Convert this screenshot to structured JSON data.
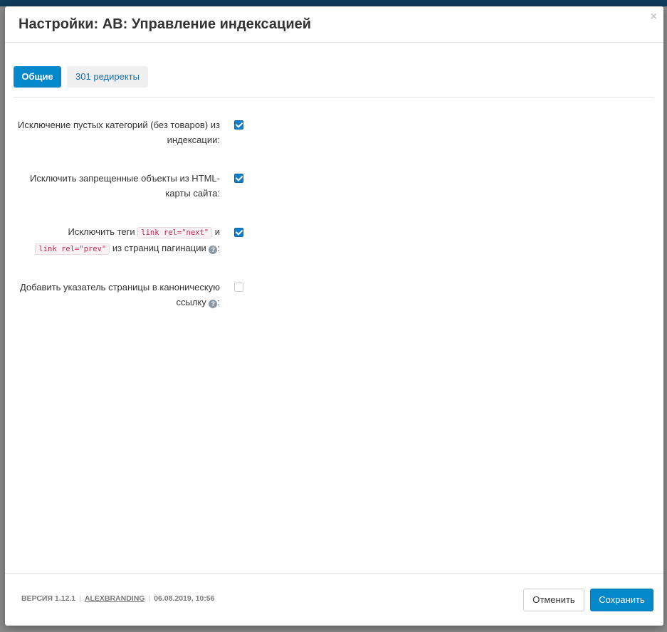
{
  "modal": {
    "title": "Настройки: AB: Управление индексацией",
    "close_glyph": "×"
  },
  "tabs": [
    {
      "label": "Общие",
      "active": true
    },
    {
      "label": "301 редиректы",
      "active": false
    }
  ],
  "settings": {
    "exclude_empty_categories": {
      "label_line1": "Исключение пустых категорий (без товаров) из",
      "label_line2": "индексации:",
      "checked": true
    },
    "exclude_forbidden_objects": {
      "label_line1": "Исключить запрещенные объекты из HTML-",
      "label_line2": "карты сайта:",
      "checked": true
    },
    "exclude_rel_tags": {
      "label_prefix": "Исключить теги",
      "tag_next": "link rel=\"next\"",
      "label_and": "и",
      "tag_prev": "link rel=\"prev\"",
      "label_suffix": "из страниц пагинации",
      "label_colon": ":",
      "checked": true
    },
    "canonical_page_pointer": {
      "label_line1": "Добавить указатель страницы в каноническую",
      "label_line2": "ссылку",
      "label_colon": ":",
      "checked": false
    }
  },
  "footer": {
    "version": "ВЕРСИЯ 1.12.1",
    "brand": "ALEXBRANDING",
    "date": "06.08.2019, 10:56",
    "cancel_label": "Отменить",
    "save_label": "Сохранить"
  },
  "icons": {
    "help": "?"
  },
  "colors": {
    "primary": "#0388cc",
    "header_bar": "#0f3b5c",
    "code_text": "#c7254e"
  }
}
